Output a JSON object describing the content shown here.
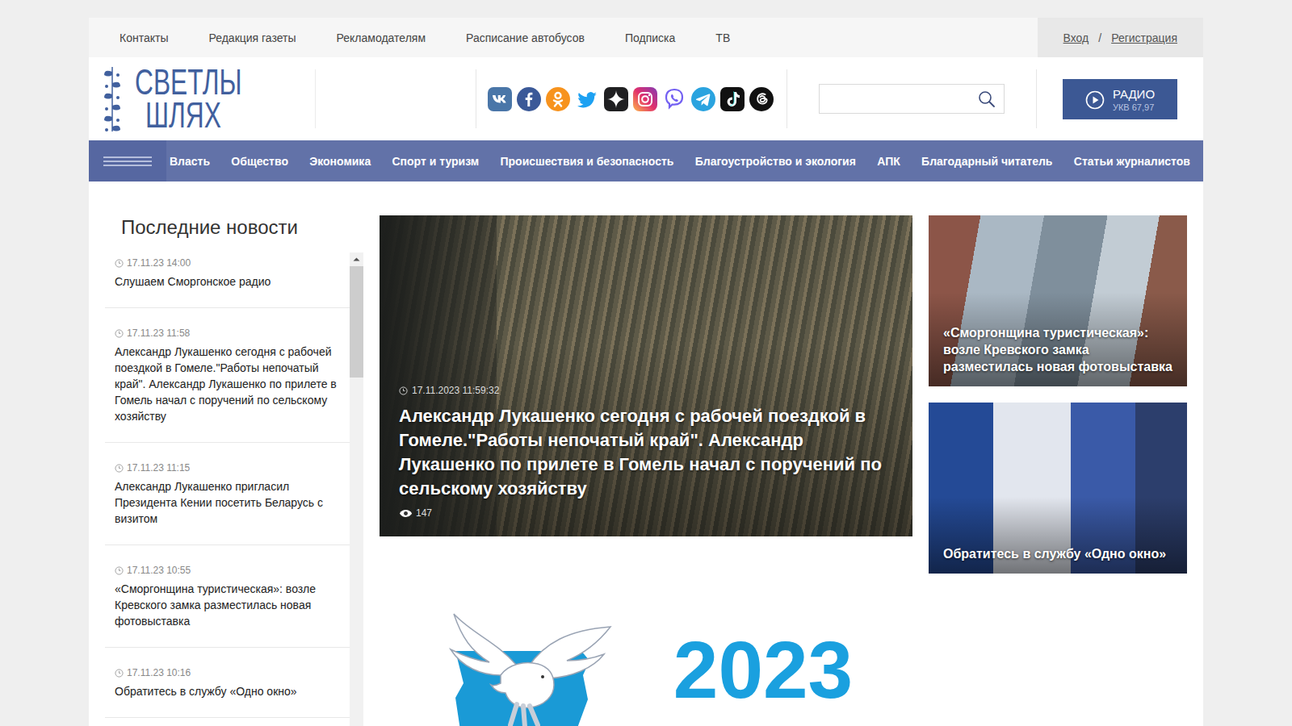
{
  "top_links": [
    "Контакты",
    "Редакция газеты",
    "Рекламодателям",
    "Расписание автобусов",
    "Подписка",
    "ТВ"
  ],
  "auth": {
    "login": "Вход",
    "separator": "/",
    "register": "Регистрация"
  },
  "logo": {
    "line1": "СВЕТЛЫ",
    "line2": "ШЛЯХ"
  },
  "search": {
    "placeholder": ""
  },
  "radio": {
    "label": "РАДИО",
    "frequency": "УКВ 67,97"
  },
  "nav": [
    {
      "label": "Власть",
      "selected": false
    },
    {
      "label": "Общество",
      "selected": false
    },
    {
      "label": "Экономика",
      "selected": false
    },
    {
      "label": "Спорт и туризм",
      "selected": false
    },
    {
      "label": "Происшествия и безопасность",
      "selected": false
    },
    {
      "label": "Благоустройство и экология",
      "selected": false
    },
    {
      "label": "АПК",
      "selected": false
    },
    {
      "label": "Благодарный читатель",
      "selected": false
    },
    {
      "label": "Статьи журналистов",
      "selected": false
    }
  ],
  "latest": {
    "title": "Последние новости",
    "scrollbar": {
      "level": 0.23
    },
    "items": [
      {
        "time": "17.11.23 14:00",
        "title": "Слушаем Сморгонское радио"
      },
      {
        "time": "17.11.23 11:58",
        "title": "Александр Лукашенко сегодня с рабочей поездкой в Гомеле.\"Работы непочатый край\". Александр Лукашенко по прилете в Гомель начал с поручений по сельскому хозяйству"
      },
      {
        "time": "17.11.23 11:15",
        "title": "Александр Лукашенко пригласил Президента Кении посетить Беларусь с визитом"
      },
      {
        "time": "17.11.23 10:55",
        "title": "«Сморгонщина туристическая»: возле Кревского замка разместилась новая фотовыставка"
      },
      {
        "time": "17.11.23 10:16",
        "title": "Обратитесь в службу «Одно окно»"
      }
    ]
  },
  "featured": {
    "time": "17.11.2023 11:59:32",
    "title": "Александр Лукашенко сегодня с рабочей поездкой в Гомеле.\"Работы непочатый край\". Александр Лукашенко по прилете в Гомель начал с поручений по сельскому хозяйству",
    "views": "147"
  },
  "side_cards": [
    {
      "title": "«Сморгонщина туристическая»: возле Кревского замка разместилась новая фотовыставка"
    },
    {
      "title": "Обратитесь в службу «Одно окно»"
    }
  ],
  "banner": {
    "year": "2023"
  }
}
